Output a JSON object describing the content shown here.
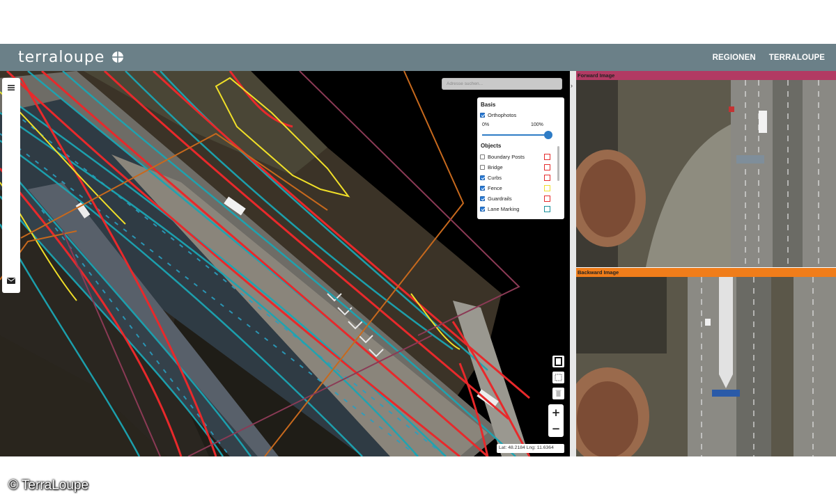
{
  "header": {
    "brand": "terraloupe",
    "nav": [
      {
        "label": "REGIONEN"
      },
      {
        "label": "TERRALOUPE"
      }
    ],
    "bg_color": "#6b8088"
  },
  "map": {
    "search_placeholder": "Adresse suchen...",
    "collapse_glyph": "›",
    "layers": {
      "basis_title": "Basis",
      "orthophotos": {
        "label": "Orthophotos",
        "checked": true
      },
      "opacity_min": "0%",
      "opacity_max": "100%",
      "opacity_value": 1.0,
      "objects_title": "Objects",
      "objects": [
        {
          "label": "Boundary Posts",
          "checked": false,
          "color": "#e52b2b"
        },
        {
          "label": "Bridge",
          "checked": false,
          "color": "#e52b2b"
        },
        {
          "label": "Curbs",
          "checked": true,
          "color": "#e52b2b"
        },
        {
          "label": "Fence",
          "checked": true,
          "color": "#f0e130"
        },
        {
          "label": "Guardrails",
          "checked": true,
          "color": "#e52b2b"
        },
        {
          "label": "Lane Marking",
          "checked": true,
          "color": "#1a8f9a"
        }
      ]
    },
    "zoom_in": "+",
    "zoom_out": "−",
    "coords": "Lat: 48.2184  Lng: 11.6364",
    "icons": [
      "menu-icon",
      "mail-icon",
      "book-icon",
      "select-area-icon",
      "trash-icon"
    ]
  },
  "forward": {
    "title": "Forward Image",
    "color": "#b23a63"
  },
  "backward": {
    "title": "Backward Image",
    "color": "#f07d1a"
  },
  "copyright": "© TerraLoupe"
}
